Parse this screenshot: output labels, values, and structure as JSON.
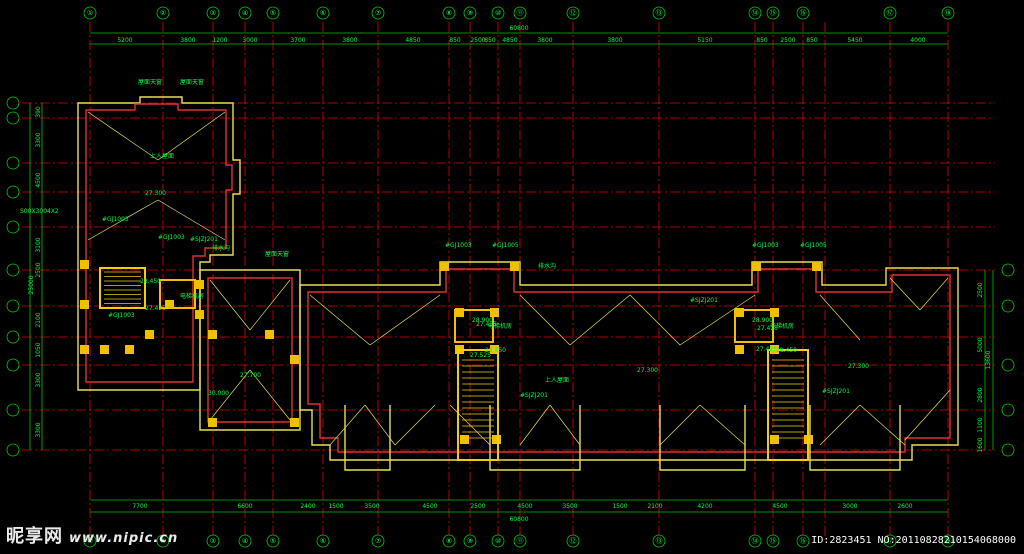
{
  "colors": {
    "background": "#000000",
    "axis_line": "#e00000",
    "dimension": "#00c000",
    "wall": "#e8e050",
    "wall_inner": "#e03030",
    "column": "#f0c000",
    "stair": "#f0d000",
    "text": "#00ff40",
    "bubble": "#00d000",
    "white": "#ffffff"
  },
  "top_axes": [
    "①",
    "②",
    "③",
    "④",
    "⑤",
    "⑥",
    "⑦",
    "⑧",
    "⑨",
    "⑩",
    "⑪",
    "⑫",
    "⑬",
    "⑭",
    "⑮",
    "⑯",
    "⑰",
    "⑱"
  ],
  "top_total": "60800",
  "top_dims": [
    "5200",
    "3800",
    "1200",
    "3000",
    "3700",
    "3800",
    "4850",
    "850",
    "2500",
    "850",
    "4850",
    "3800",
    "3800",
    "5150",
    "850",
    "2500",
    "850",
    "5450",
    "4000"
  ],
  "bottom_total": "60800",
  "bottom_dims": [
    "7700",
    "6600",
    "2400",
    "1500",
    "3500",
    "4500",
    "2500",
    "4500",
    "3500",
    "1500",
    "2100",
    "4200",
    "4500",
    "3000",
    "2600"
  ],
  "left_dims": [
    "390",
    "3300",
    "4500",
    "3100",
    "2500",
    "2100",
    "1050",
    "3300",
    "3300"
  ],
  "left_total": "25000",
  "right_dims": [
    "2500",
    "5000",
    "2800",
    "1100",
    "1600"
  ],
  "right_total": "13600",
  "labels": [
    "上人屋面",
    "上人屋面",
    "电梯机房",
    "电梯机房",
    "电梯机房",
    "27.300",
    "27.300",
    "27.300",
    "30.000",
    "27.700",
    "28.900",
    "28.900",
    "28.450",
    "27.425",
    "27.425",
    "27.425",
    "28.450",
    "28.450",
    "27.525",
    "27.425",
    "#GJ1003",
    "#GJ1003",
    "#GJ1003",
    "#GJ1003",
    "#GJ1003",
    "#SJZJ201",
    "#SJZJ201",
    "#SJZJ201",
    "#SJZJ201",
    "#GJ1005",
    "#GJ1005",
    "排水沟",
    "排水沟",
    "屋面天窗",
    "屋面天窗",
    "屋面天窗",
    "S00X3004X2"
  ],
  "watermark": {
    "brand": "昵享网",
    "site": "www.nipic.cn",
    "id": "ID:2823451 NO:20110828210154068000"
  }
}
